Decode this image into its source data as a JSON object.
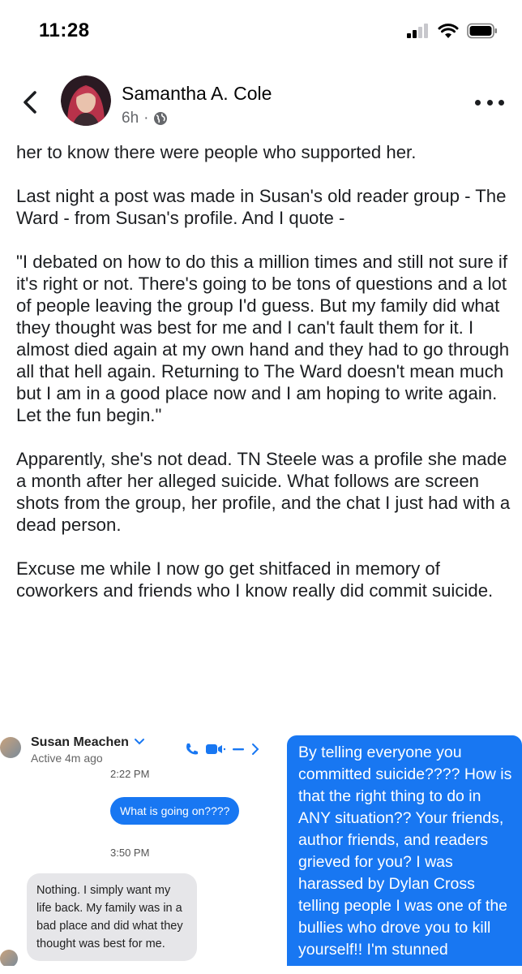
{
  "status_bar": {
    "time": "11:28",
    "icons": [
      "cellular-signal-icon",
      "wifi-icon",
      "battery-icon"
    ]
  },
  "header": {
    "author": "Samantha A. Cole",
    "time_ago": "6h",
    "separator": "·",
    "audience_icon": "globe-icon"
  },
  "post": {
    "paragraphs": [
      "her to know there were people who supported her.",
      "Last night a post was made in Susan's old reader group - The Ward - from Susan's profile. And I quote -",
      "\"I debated on how to do this a million times and still not sure if it's right or not. There's going to be tons of questions and a lot of people leaving the group I'd guess. But my family did what they thought was best for me and I can't fault them for it. I almost died again at my own hand and they had to go through all that hell again. Returning to The Ward doesn't mean much but I am in a good place now and I am hoping to write again. Let the fun begin.\"",
      "Apparently, she's not dead. TN Steele was a profile she made a month after her alleged suicide. What follows are screen shots from the group, her profile, and the chat I just had with a dead person.",
      "Excuse me while I now go get shitfaced in memory of coworkers and friends who I know really did commit suicide."
    ]
  },
  "screenshot_left": {
    "contact_name": "Susan Meachen",
    "status": "Active 4m ago",
    "timestamp_1": "2:22 PM",
    "sent_message": "What is going on????",
    "timestamp_2": "3:50 PM",
    "received_message": "Nothing. I simply want my life back. My family was in a bad place and did what they thought was best for me."
  },
  "screenshot_right": {
    "message": "By telling everyone you committed suicide???? How is that the right thing to do in ANY situation?? Your friends, author friends, and readers grieved for you? I was harassed by Dylan Cross telling people I was one of the bullies who drove you to kill yourself!! I'm stunned"
  },
  "colors": {
    "messenger_blue": "#1877f2",
    "received_bubble": "#e6e6e9",
    "meta_gray": "#65676b"
  }
}
